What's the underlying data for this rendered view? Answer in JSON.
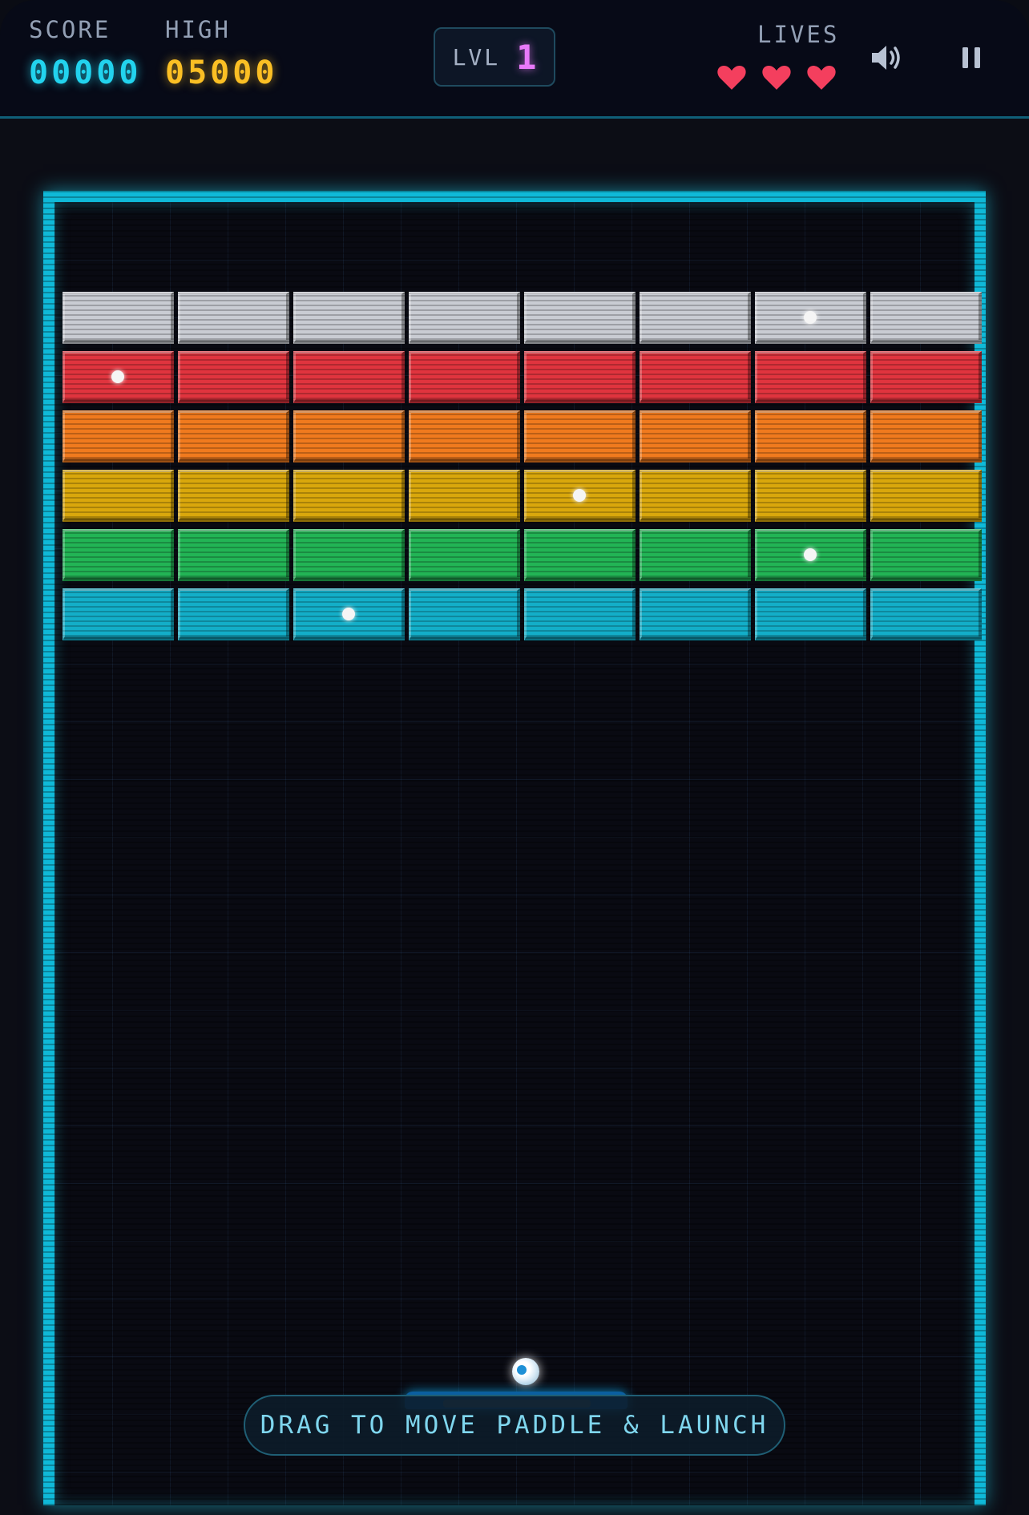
{
  "hud": {
    "score_label": "SCORE",
    "score_value": "00000",
    "high_label": "HIGH",
    "high_value": "05000",
    "level_label": "LVL",
    "level_value": "1",
    "lives_label": "LIVES",
    "lives_count": 3,
    "sound_icon": "speaker-icon",
    "pause_icon": "pause-icon"
  },
  "colors": {
    "score": "#22d3ee",
    "high": "#fbbf24",
    "level": "#e879f9",
    "heart": "#f43f5e",
    "border": "#0fb9d8",
    "rows": [
      "#c9ccd3",
      "#e0343e",
      "#f07a1e",
      "#d9a70c",
      "#22b455",
      "#13aec8"
    ]
  },
  "bricks": {
    "rows": 6,
    "columns": 8,
    "sparks": [
      [
        0,
        6
      ],
      [
        1,
        0
      ],
      [
        3,
        4
      ],
      [
        4,
        6
      ],
      [
        5,
        2
      ]
    ]
  },
  "hint": {
    "text": "DRAG TO MOVE PADDLE & LAUNCH"
  }
}
